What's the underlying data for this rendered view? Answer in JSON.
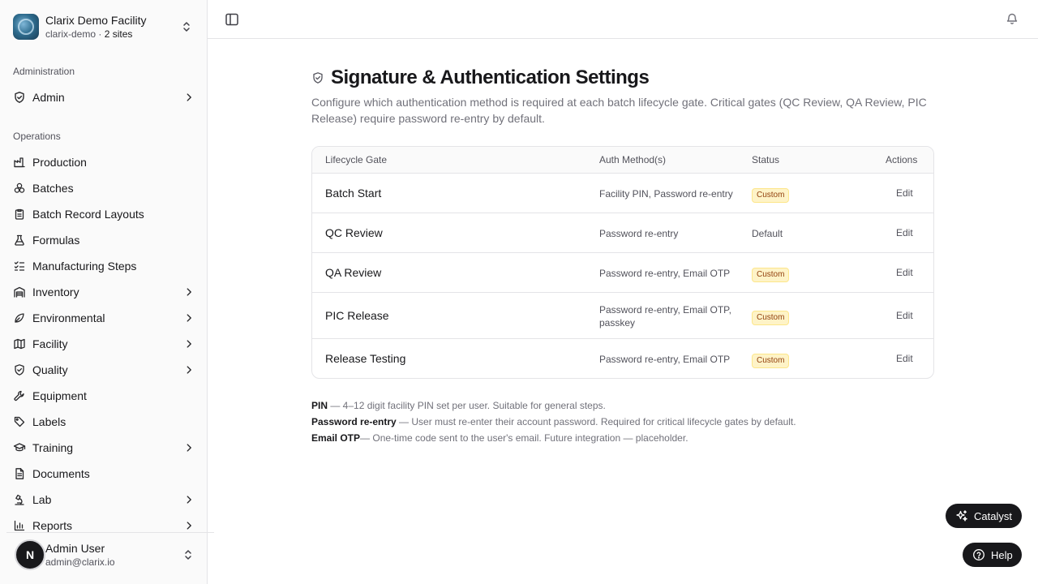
{
  "org": {
    "name": "Clarix Demo Facility",
    "slug": "clarix-demo",
    "sites": "2 sites"
  },
  "sidebar": {
    "admin_section": "Administration",
    "admin_item": "Admin",
    "ops_section": "Operations",
    "items": [
      {
        "label": "Production",
        "icon": "factory-icon",
        "expandable": false
      },
      {
        "label": "Batches",
        "icon": "boxes-icon",
        "expandable": false
      },
      {
        "label": "Batch Record Layouts",
        "icon": "clipboard-icon",
        "expandable": false
      },
      {
        "label": "Formulas",
        "icon": "flask-icon",
        "expandable": false
      },
      {
        "label": "Manufacturing Steps",
        "icon": "list-checks-icon",
        "expandable": false
      },
      {
        "label": "Inventory",
        "icon": "warehouse-icon",
        "expandable": true
      },
      {
        "label": "Environmental",
        "icon": "leaf-icon",
        "expandable": true
      },
      {
        "label": "Facility",
        "icon": "map-icon",
        "expandable": true
      },
      {
        "label": "Quality",
        "icon": "shield-check-icon",
        "expandable": true
      },
      {
        "label": "Equipment",
        "icon": "wrench-icon",
        "expandable": false
      },
      {
        "label": "Labels",
        "icon": "tag-icon",
        "expandable": false
      },
      {
        "label": "Training",
        "icon": "graduation-cap-icon",
        "expandable": true
      },
      {
        "label": "Documents",
        "icon": "file-text-icon",
        "expandable": false
      },
      {
        "label": "Lab",
        "icon": "microscope-icon",
        "expandable": true
      },
      {
        "label": "Reports",
        "icon": "bar-chart-icon",
        "expandable": true
      }
    ]
  },
  "user": {
    "initial": "N",
    "name": "Admin User",
    "email": "admin@clarix.io"
  },
  "page": {
    "title": "Signature & Authentication Settings",
    "description": "Configure which authentication method is required at each batch lifecycle gate. Critical gates (QC Review, QA Review, PIC Release) require password re-entry by default."
  },
  "table": {
    "headers": {
      "gate": "Lifecycle Gate",
      "method": "Auth Method(s)",
      "status": "Status",
      "actions": "Actions"
    },
    "rows": [
      {
        "gate": "Batch Start",
        "method": "Facility PIN, Password re-entry",
        "status": "Custom",
        "action": "Edit"
      },
      {
        "gate": "QC Review",
        "method": "Password re-entry",
        "status": "Default",
        "action": "Edit"
      },
      {
        "gate": "QA Review",
        "method": "Password re-entry, Email OTP",
        "status": "Custom",
        "action": "Edit"
      },
      {
        "gate": "PIC Release",
        "method": "Password re-entry, Email OTP, passkey",
        "status": "Custom",
        "action": "Edit"
      },
      {
        "gate": "Release Testing",
        "method": "Password re-entry, Email OTP",
        "status": "Custom",
        "action": "Edit"
      }
    ]
  },
  "legend": [
    {
      "term": "PIN",
      "text": " — 4–12 digit facility PIN set per user. Suitable for general steps."
    },
    {
      "term": "Password re-entry",
      "text": " — User must re-enter their account password. Required for critical lifecycle gates by default."
    },
    {
      "term": "Email OTP",
      "text": "— One-time code sent to the user's email. Future integration — placeholder."
    }
  ],
  "fabs": {
    "catalyst": "Catalyst",
    "help": "Help"
  },
  "colors": {
    "badge_bg": "#fef3c7",
    "badge_text": "#92400e",
    "fab_bg": "#18181b"
  }
}
